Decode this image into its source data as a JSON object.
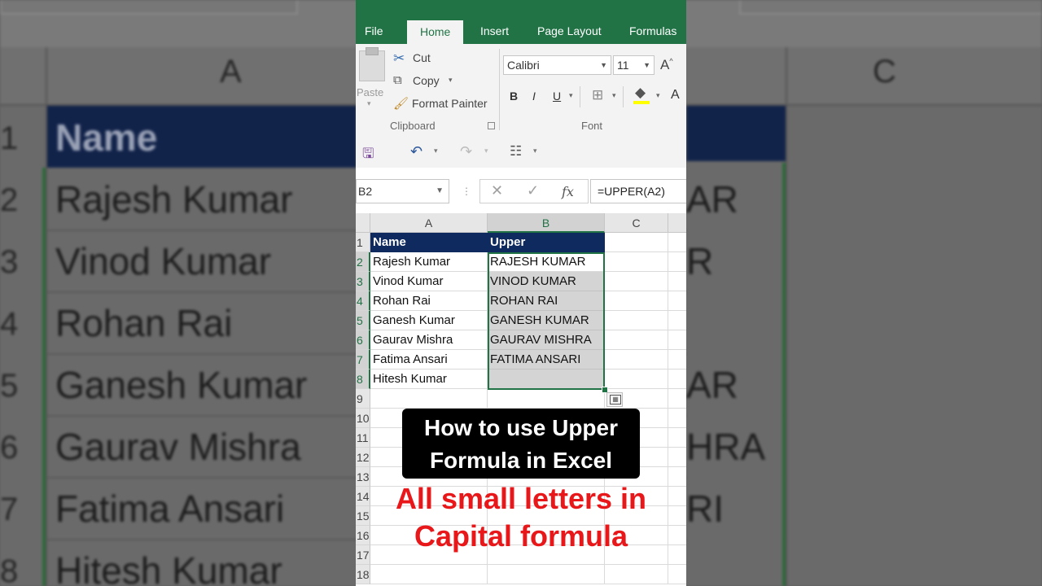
{
  "background": {
    "column_labels": [
      "A",
      "C"
    ],
    "row_numbers": [
      "1",
      "2",
      "3",
      "4",
      "5",
      "6",
      "7",
      "8"
    ],
    "header": "Name",
    "names": [
      "Rajesh Kumar",
      "Vinod Kumar",
      "Rohan Rai",
      "Ganesh Kumar",
      "Gaurav Mishra",
      "Fatima Ansari",
      "Hitesh Kumar"
    ],
    "right_fragments": [
      "AR",
      "R",
      "",
      "AR",
      "HRA",
      "RI",
      ""
    ]
  },
  "ribbon": {
    "tabs": [
      "File",
      "Home",
      "Insert",
      "Page Layout",
      "Formulas"
    ],
    "active_tab": "Home",
    "clipboard": {
      "paste": "Paste",
      "cut": "Cut",
      "copy": "Copy",
      "format_painter": "Format Painter",
      "group_label": "Clipboard"
    },
    "font": {
      "family": "Calibri",
      "size": "11",
      "grow_label": "A",
      "bold": "B",
      "italic": "I",
      "underline": "U",
      "color_label": "A",
      "group_label": "Font"
    }
  },
  "formula_bar": {
    "name_box": "B2",
    "fx": "fx",
    "formula": "=UPPER(A2)"
  },
  "sheet": {
    "columns": [
      "A",
      "B",
      "C"
    ],
    "row_numbers": [
      "1",
      "2",
      "3",
      "4",
      "5",
      "6",
      "7",
      "8",
      "9",
      "10",
      "11",
      "12",
      "13",
      "14",
      "15",
      "16",
      "17",
      "18"
    ],
    "header": {
      "a": "Name",
      "b": "Upper"
    },
    "rows": [
      {
        "a": "Rajesh Kumar",
        "b": "RAJESH KUMAR"
      },
      {
        "a": "Vinod Kumar",
        "b": "VINOD KUMAR"
      },
      {
        "a": "Rohan Rai",
        "b": "ROHAN RAI"
      },
      {
        "a": "Ganesh Kumar",
        "b": "GANESH KUMAR"
      },
      {
        "a": "Gaurav Mishra",
        "b": "GAURAV MISHRA"
      },
      {
        "a": "Fatima Ansari",
        "b": "FATIMA ANSARI"
      },
      {
        "a": "Hitesh Kumar",
        "b": ""
      }
    ]
  },
  "overlay": {
    "caption_line1": "How to use Upper",
    "caption_line2": "Formula in Excel",
    "red_line1": "All small letters in",
    "red_line2": "Capital formula"
  },
  "colors": {
    "excel_green": "#217346",
    "header_navy": "#0f2a5f",
    "caption_red": "#e8171a"
  }
}
